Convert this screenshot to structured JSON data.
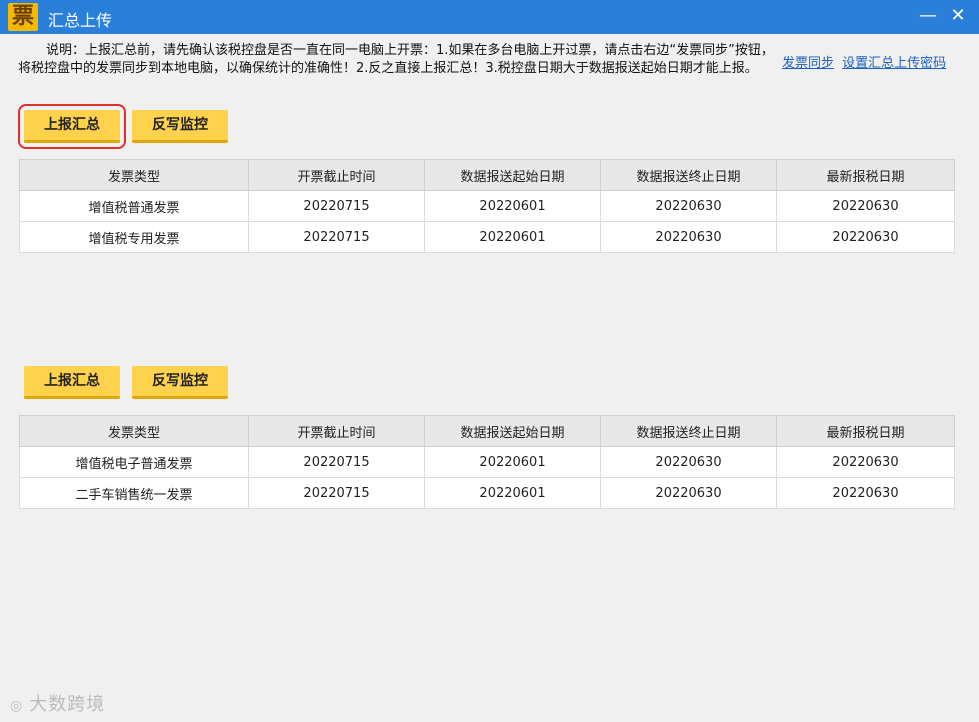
{
  "window": {
    "title": "汇总上传",
    "app_icon": "票",
    "minimize_glyph": "—",
    "close_glyph": "✕"
  },
  "notice": "说明：上报汇总前，请先确认该税控盘是否一直在同一电脑上开票：1.如果在多台电脑上开过票，请点击右边“发票同步”按钮，将税控盘中的发票同步到本地电脑，以确保统计的准确性！2.反之直接上报汇总！3.税控盘日期大于数据报送起始日期才能上报。",
  "links": {
    "sync": "发票同步",
    "set_password": "设置汇总上传密码"
  },
  "buttons": {
    "report_summary": "上报汇总",
    "writeback_monitor": "反写监控"
  },
  "columns": [
    "发票类型",
    "开票截止时间",
    "数据报送起始日期",
    "数据报送终止日期",
    "最新报税日期"
  ],
  "table1": {
    "rows": [
      [
        "增值税普通发票",
        "20220715",
        "20220601",
        "20220630",
        "20220630"
      ],
      [
        "增值税专用发票",
        "20220715",
        "20220601",
        "20220630",
        "20220630"
      ]
    ]
  },
  "table2": {
    "rows": [
      [
        "增值税电子普通发票",
        "20220715",
        "20220601",
        "20220630",
        "20220630"
      ],
      [
        "二手车销售统一发票",
        "20220715",
        "20220601",
        "20220630",
        "20220630"
      ]
    ]
  },
  "watermark": {
    "text": "大数跨境",
    "logo": "◎"
  },
  "colors": {
    "titlebar": "#2a7fd9",
    "button": "#ffd24d",
    "link": "#1d5fbf",
    "selection_border": "#e0302a"
  }
}
